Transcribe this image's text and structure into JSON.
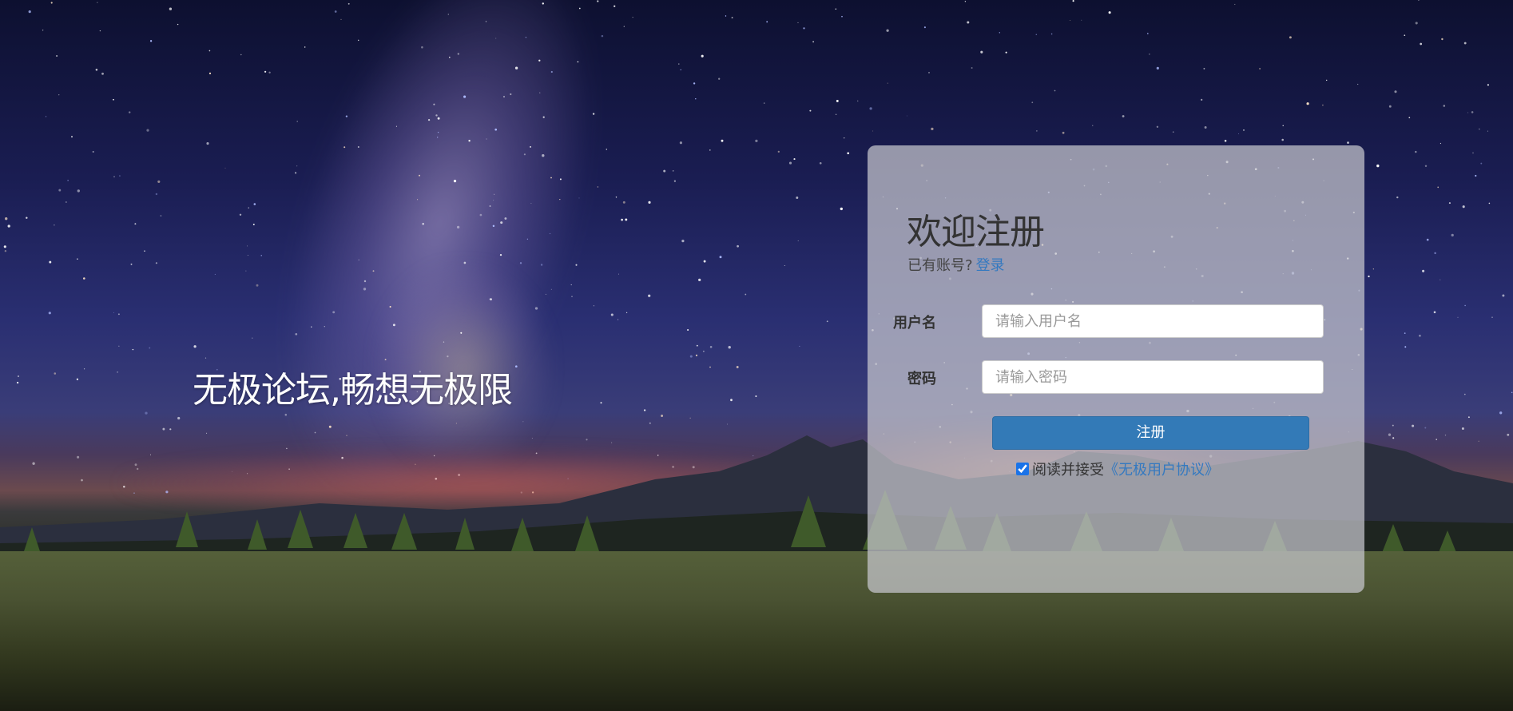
{
  "slogan": "无极论坛,畅想无极限",
  "register": {
    "title": "欢迎注册",
    "have_account_text": "已有账号?",
    "login_link": "登录",
    "username_label": "用户名",
    "username_placeholder": "请输入用户名",
    "username_value": "",
    "password_label": "密码",
    "password_placeholder": "请输入密码",
    "password_value": "",
    "submit_label": "注册",
    "agree_checked": true,
    "agree_text": "阅读并接受",
    "agreement_link": "《无极用户协议》"
  },
  "colors": {
    "primary_button": "#337ab7",
    "link": "#3479c0",
    "panel_background": "rgba(200,200,206,0.72)"
  }
}
